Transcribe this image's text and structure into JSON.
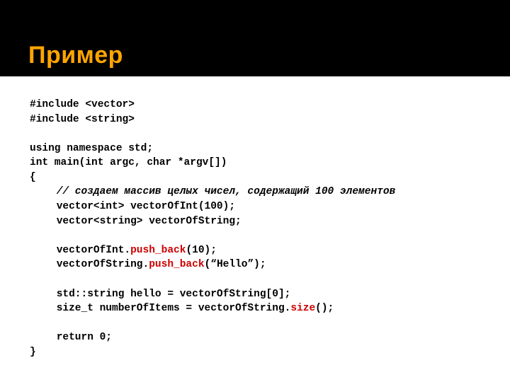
{
  "title": "Пример",
  "code": {
    "l1a": "#include ",
    "l1b": "<vector>",
    "l2a": "#include ",
    "l2b": "<string>",
    "l3": "",
    "l4": "using namespace std;",
    "l5": "int main(int argc, char *argv[])",
    "l6": "{",
    "l7": "// создаем массив целых чисел, содержащий 100 элементов",
    "l8": "vector<int> vectorOfInt(100);",
    "l9": "vector<string> vectorOfString;",
    "l10": "",
    "l11a": "vectorOfInt.",
    "l11m": "push_back",
    "l11b": "(10);",
    "l12a": "vectorOfString.",
    "l12m": "push_back",
    "l12b": "(“Hello”);",
    "l13": "",
    "l14": "std::string hello = vectorOfString[0];",
    "l15a": "size_t numberOfItems = vectorOfString.",
    "l15m": "size",
    "l15b": "();",
    "l16": "",
    "l17": "return 0;",
    "l18": "}"
  }
}
